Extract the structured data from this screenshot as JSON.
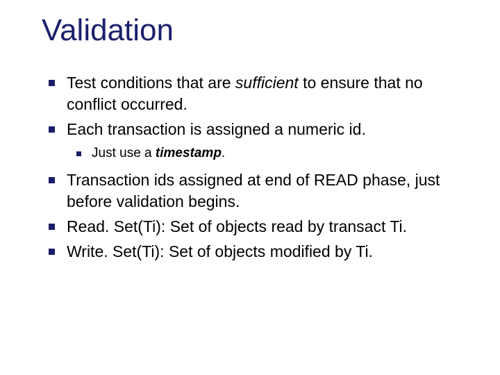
{
  "title": "Validation",
  "bullets": {
    "b1_a": "Test conditions that are ",
    "b1_emph": "sufficient",
    "b1_b": " to ensure that no conflict occurred.",
    "b2": "Each transaction is assigned a numeric id.",
    "b2_sub_a": "Just use a ",
    "b2_sub_strong": "timestamp",
    "b2_sub_b": ".",
    "b3": "Transaction ids assigned at end of READ phase, just before validation begins.",
    "b4": "Read. Set(Ti):  Set of objects read by transact Ti.",
    "b5": "Write. Set(Ti):  Set of objects modified by Ti."
  }
}
